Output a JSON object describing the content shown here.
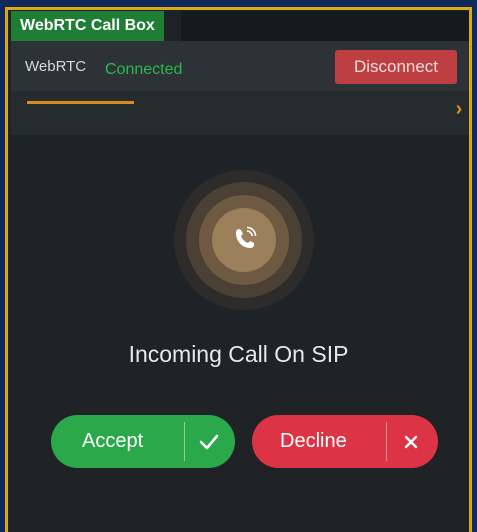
{
  "widget": {
    "title": "WebRTC Call Box",
    "accent_color": "#d9a914"
  },
  "status": {
    "name": "WebRTC",
    "state": "Connected",
    "state_color": "#2fb84a",
    "disconnect_label": "Disconnect"
  },
  "nav": {
    "chevron_icon": "chevron-right-icon",
    "chevron": "›"
  },
  "call": {
    "icon": "phone-ringing-icon",
    "title": "Incoming Call On SIP",
    "accept_label": "Accept",
    "accept_icon": "check-icon",
    "decline_label": "Decline",
    "decline_icon": "close-icon",
    "accept_color": "#2aa84a",
    "decline_color": "#dc3444"
  }
}
